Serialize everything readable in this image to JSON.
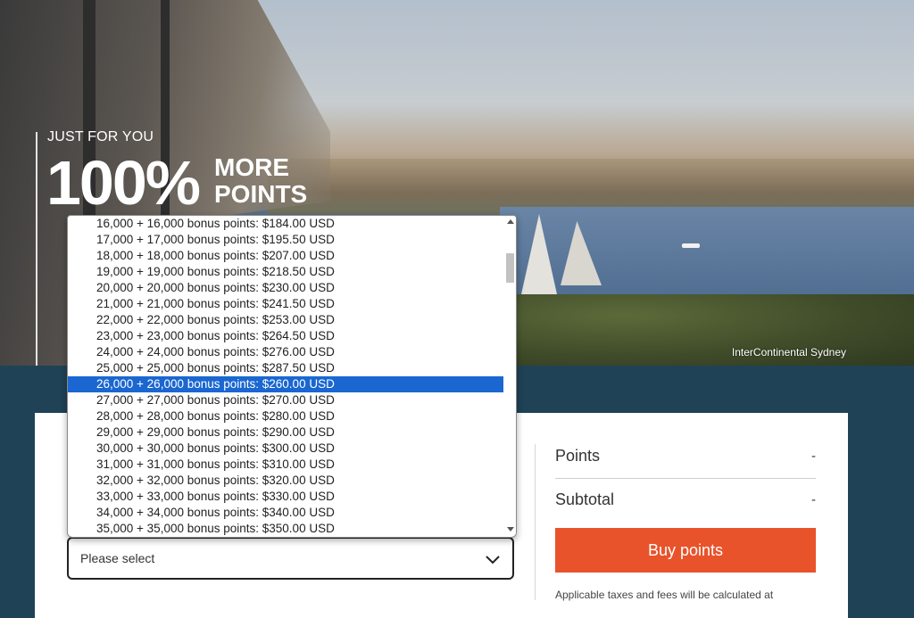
{
  "hero": {
    "eyebrow": "JUST FOR YOU",
    "headline_number": "100%",
    "headline_more": "MORE",
    "headline_points": "POINTS",
    "photo_caption": "InterContinental Sydney"
  },
  "purchase": {
    "select": {
      "value": "Please select",
      "options": [
        "16,000 + 16,000 bonus points: $184.00 USD",
        "17,000 + 17,000 bonus points: $195.50 USD",
        "18,000 + 18,000 bonus points: $207.00 USD",
        "19,000 + 19,000 bonus points: $218.50 USD",
        "20,000 + 20,000 bonus points: $230.00 USD",
        "21,000 + 21,000 bonus points: $241.50 USD",
        "22,000 + 22,000 bonus points: $253.00 USD",
        "23,000 + 23,000 bonus points: $264.50 USD",
        "24,000 + 24,000 bonus points: $276.00 USD",
        "25,000 + 25,000 bonus points: $287.50 USD",
        "26,000 + 26,000 bonus points: $260.00 USD",
        "27,000 + 27,000 bonus points: $270.00 USD",
        "28,000 + 28,000 bonus points: $280.00 USD",
        "29,000 + 29,000 bonus points: $290.00 USD",
        "30,000 + 30,000 bonus points: $300.00 USD",
        "31,000 + 31,000 bonus points: $310.00 USD",
        "32,000 + 32,000 bonus points: $320.00 USD",
        "33,000 + 33,000 bonus points: $330.00 USD",
        "34,000 + 34,000 bonus points: $340.00 USD",
        "35,000 + 35,000 bonus points: $350.00 USD"
      ],
      "highlighted_index": 10
    }
  },
  "summary": {
    "points_label": "Points",
    "points_value": "-",
    "subtotal_label": "Subtotal",
    "subtotal_value": "-",
    "buy_label": "Buy points",
    "tax_note": "Applicable taxes and fees will be calculated at"
  },
  "colors": {
    "page_bg": "#1f4256",
    "buy_button": "#e8532b",
    "option_highlight": "#1a67d1"
  }
}
